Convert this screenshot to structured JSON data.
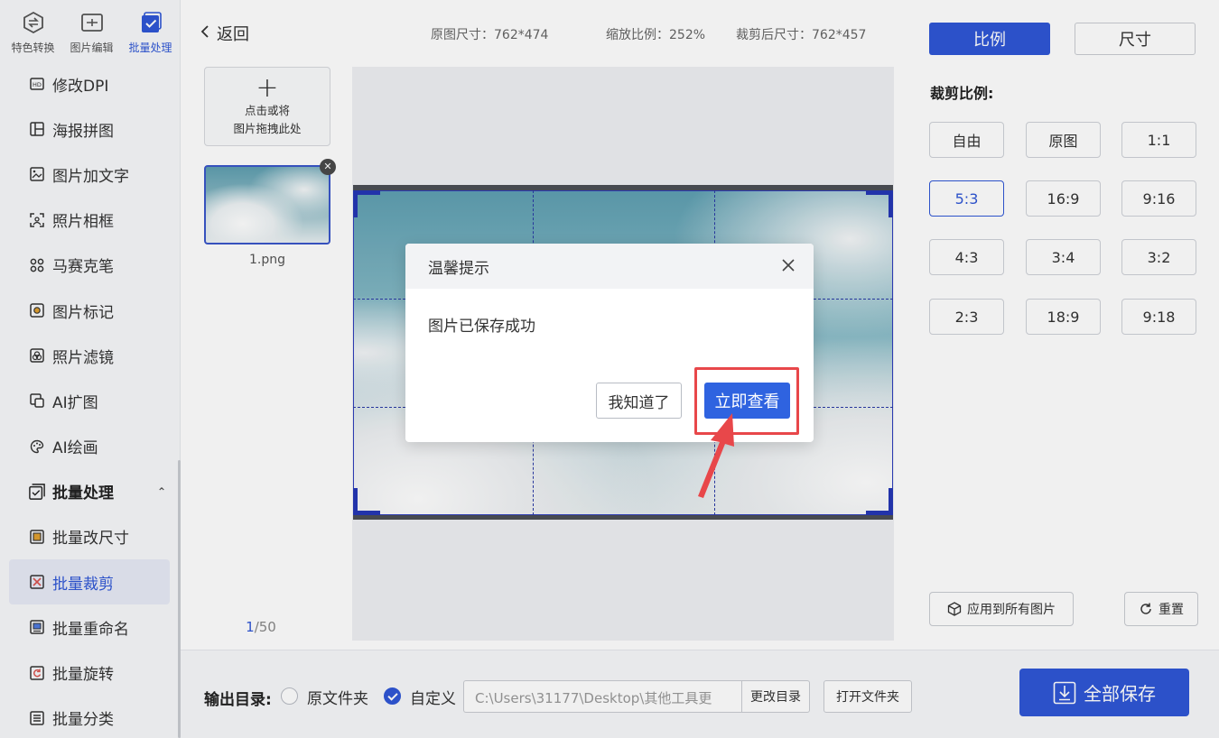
{
  "top_tabs": [
    {
      "label": "特色转换",
      "icon": "convert-icon"
    },
    {
      "label": "图片编辑",
      "icon": "image-edit-icon"
    },
    {
      "label": "批量处理",
      "icon": "batch-icon",
      "active": true
    }
  ],
  "menu": {
    "items": [
      {
        "label": "修改DPI",
        "icon": "hd-icon"
      },
      {
        "label": "海报拼图",
        "icon": "collage-icon"
      },
      {
        "label": "图片加文字",
        "icon": "text-image-icon"
      },
      {
        "label": "照片相框",
        "icon": "frame-icon"
      },
      {
        "label": "马赛克笔",
        "icon": "mosaic-icon"
      },
      {
        "label": "图片标记",
        "icon": "marker-icon"
      },
      {
        "label": "照片滤镜",
        "icon": "filter-icon"
      },
      {
        "label": "AI扩图",
        "icon": "ai-expand-icon"
      },
      {
        "label": "AI绘画",
        "icon": "ai-paint-icon"
      }
    ],
    "group": {
      "label": "批量处理",
      "caret": "⌃",
      "icon": "batch-icon"
    },
    "sub_items": [
      {
        "label": "批量改尺寸",
        "icon": "resize-icon"
      },
      {
        "label": "批量裁剪",
        "icon": "crop-icon",
        "active": true
      },
      {
        "label": "批量重命名",
        "icon": "rename-icon"
      },
      {
        "label": "批量旋转",
        "icon": "rotate-icon"
      },
      {
        "label": "批量分类",
        "icon": "classify-icon"
      }
    ]
  },
  "topbar": {
    "back_label": "返回",
    "original_size": "原图尺寸：762*474",
    "zoom": "缩放比例：252%",
    "cropped_size": "裁剪后尺寸：762*457"
  },
  "thumbs": {
    "add_line1": "点击或将",
    "add_line2": "图片拖拽此处",
    "file_name": "1.png",
    "page_current": "1",
    "page_total": "/50"
  },
  "right_panel": {
    "tab_ratio": "比例",
    "tab_size": "尺寸",
    "ratio_title": "裁剪比例:",
    "ratios": [
      "自由",
      "原图",
      "1:1",
      "5:3",
      "16:9",
      "9:16",
      "4:3",
      "3:4",
      "3:2",
      "2:3",
      "18:9",
      "9:18"
    ],
    "selected_ratio": "5:3",
    "apply_all": "应用到所有图片",
    "reset": "重置"
  },
  "bottom": {
    "output_label": "输出目录:",
    "option_original": "原文件夹",
    "option_custom": "自定义",
    "path_value": "C:\\Users\\31177\\Desktop\\其他工具更",
    "change_dir": "更改目录",
    "open_folder": "打开文件夹",
    "save_all": "全部保存"
  },
  "modal": {
    "title": "温馨提示",
    "message": "图片已保存成功",
    "ok_label": "我知道了",
    "view_label": "立即查看"
  },
  "colors": {
    "accent": "#2f57d6",
    "highlight": "#e8474a",
    "sidebar_bg": "#f7f8fa"
  }
}
